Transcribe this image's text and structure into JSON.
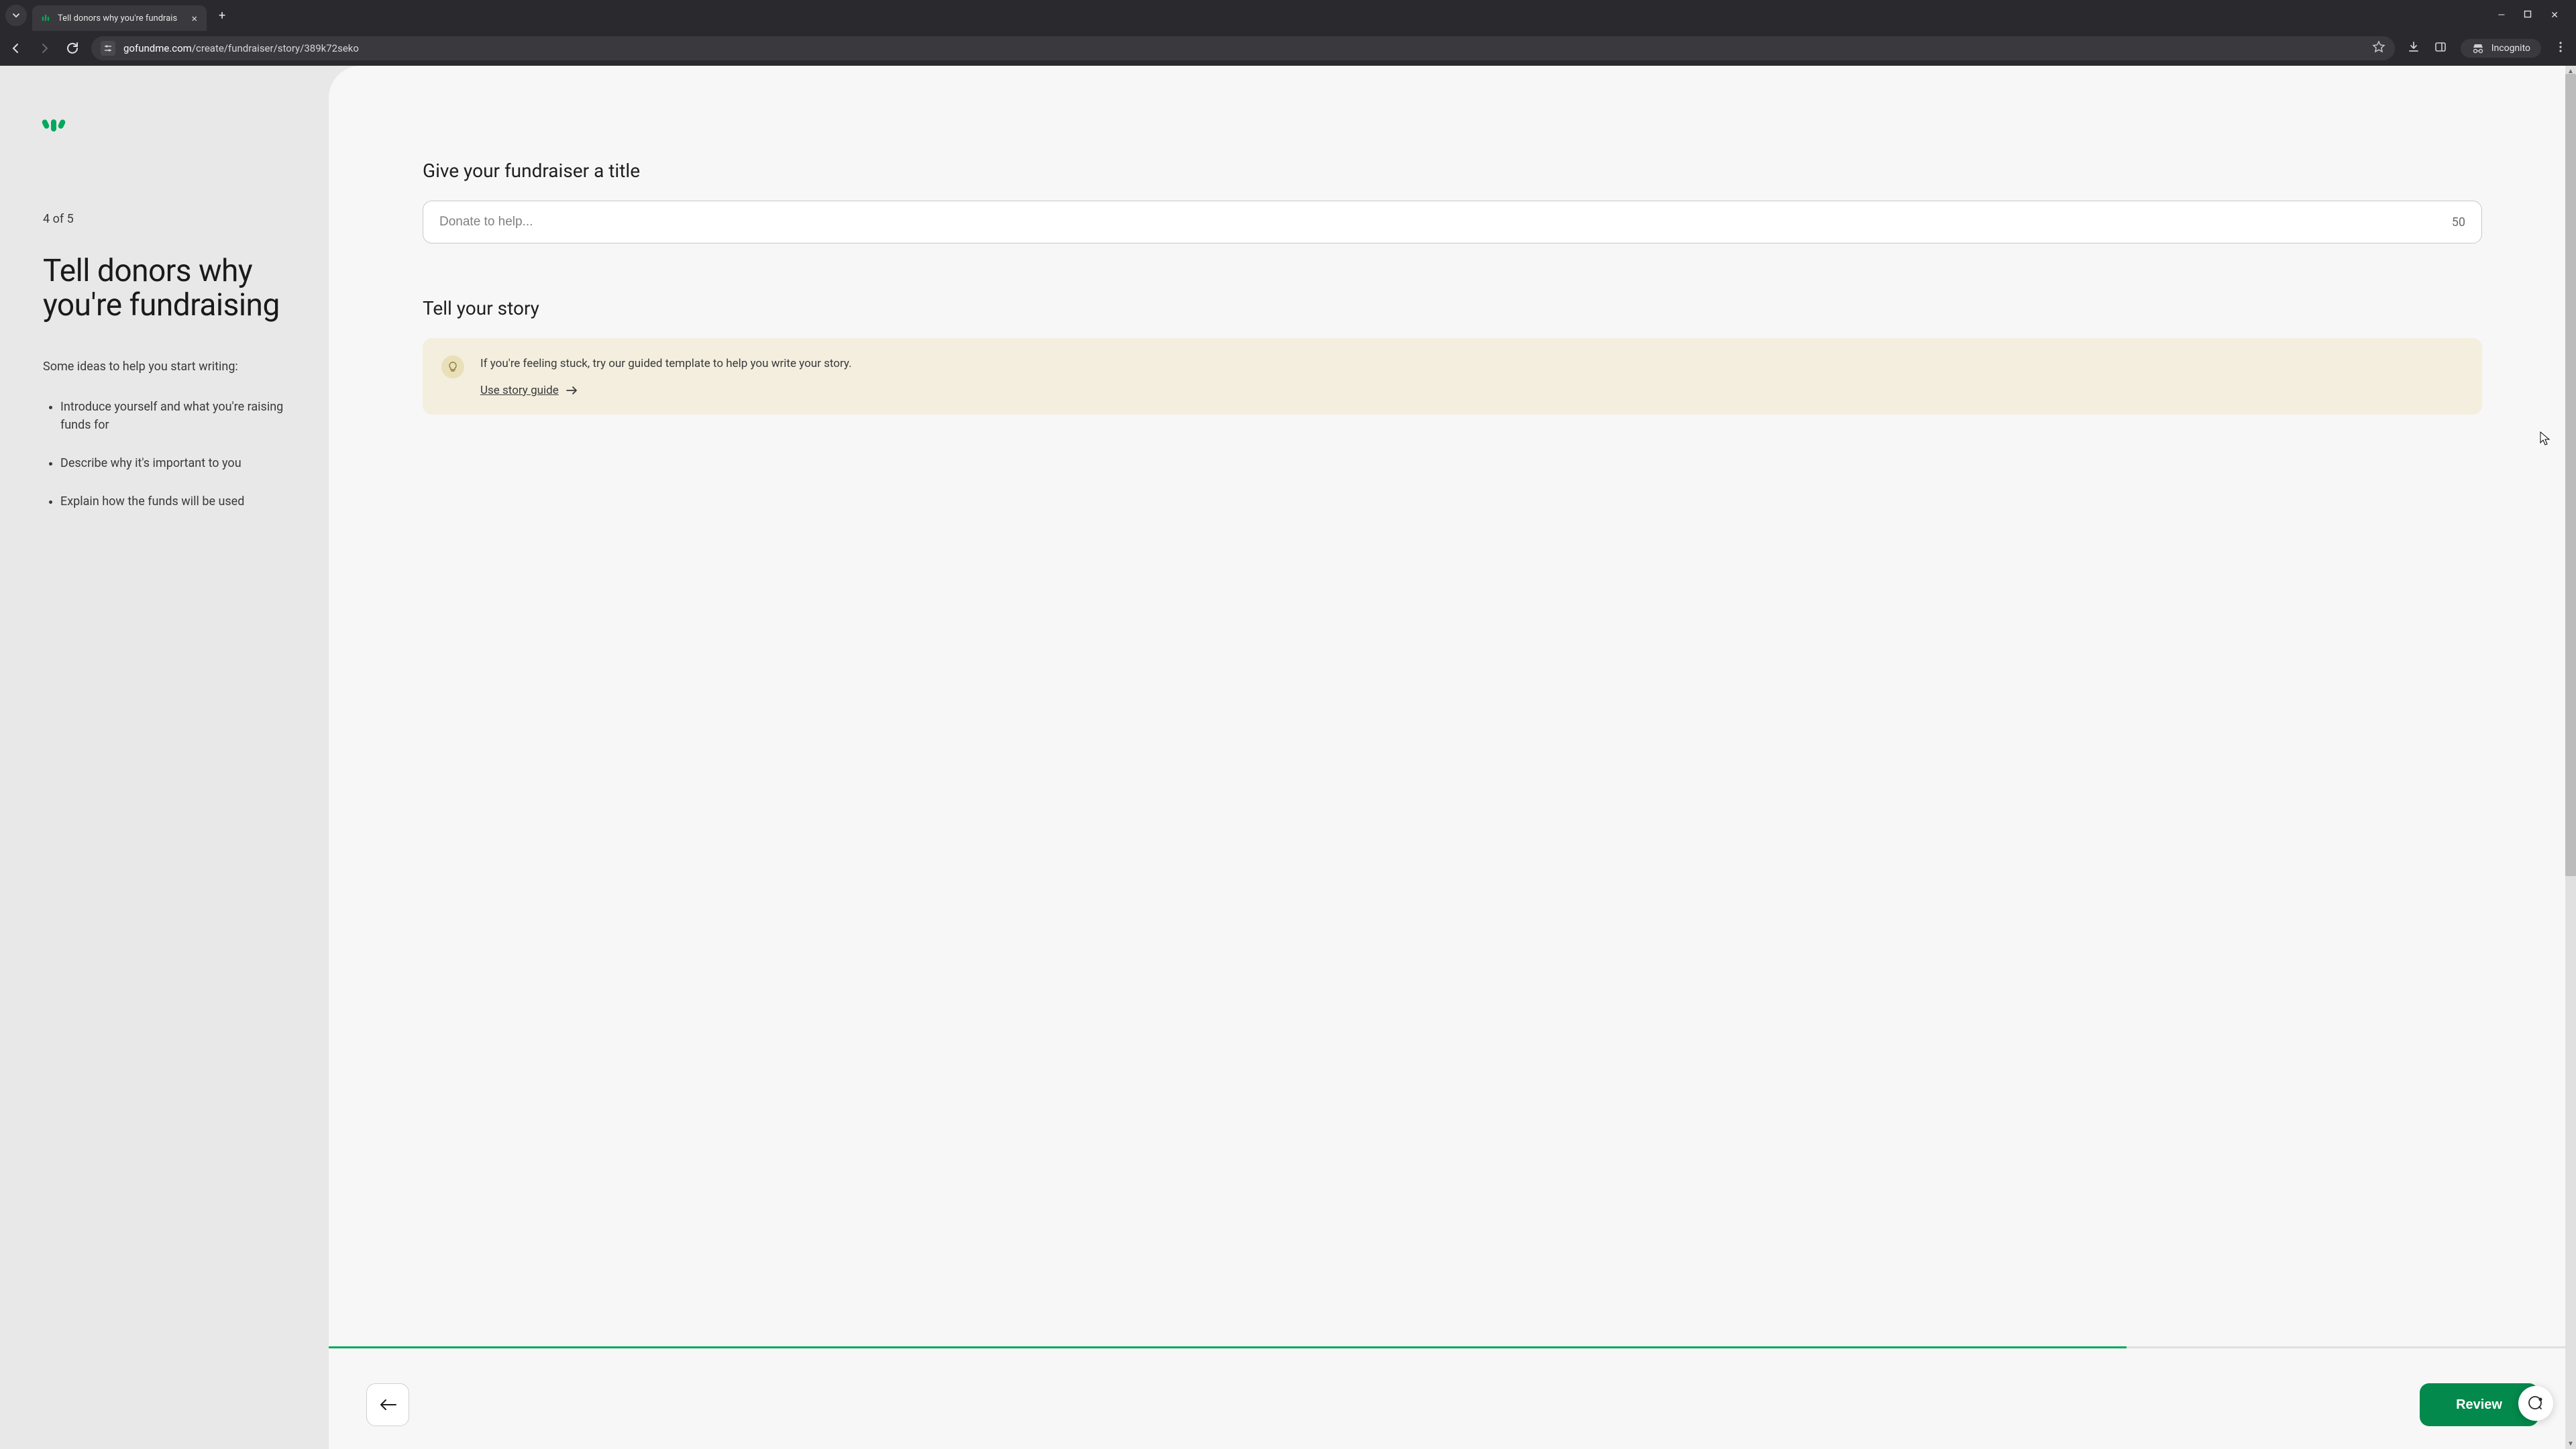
{
  "browser": {
    "tab_title": "Tell donors why you're fundrais",
    "url_domain": "gofundme.com",
    "url_path": "/create/fundraiser/story/389k72seko",
    "incognito_label": "Incognito"
  },
  "left": {
    "step_counter": "4 of 5",
    "heading": "Tell donors why you're fundraising",
    "intro": "Some ideas to help you start writing:",
    "bullets": [
      "Introduce yourself and what you're raising funds for",
      "Describe why it's important to you",
      "Explain how the funds will be used"
    ]
  },
  "right": {
    "title_label": "Give your fundraiser a title",
    "title_placeholder": "Donate to help...",
    "title_char_limit": "50",
    "story_label": "Tell your story",
    "hint_text": "If you're feeling stuck, try our guided template to help you write your story.",
    "hint_link": "Use story guide",
    "back_aria": "Back",
    "review_label": "Review",
    "progress_percent": 80
  },
  "icons": {
    "tab_close": "×",
    "new_tab": "+",
    "minimize": "—",
    "maximize": "▢",
    "close": "✕"
  }
}
